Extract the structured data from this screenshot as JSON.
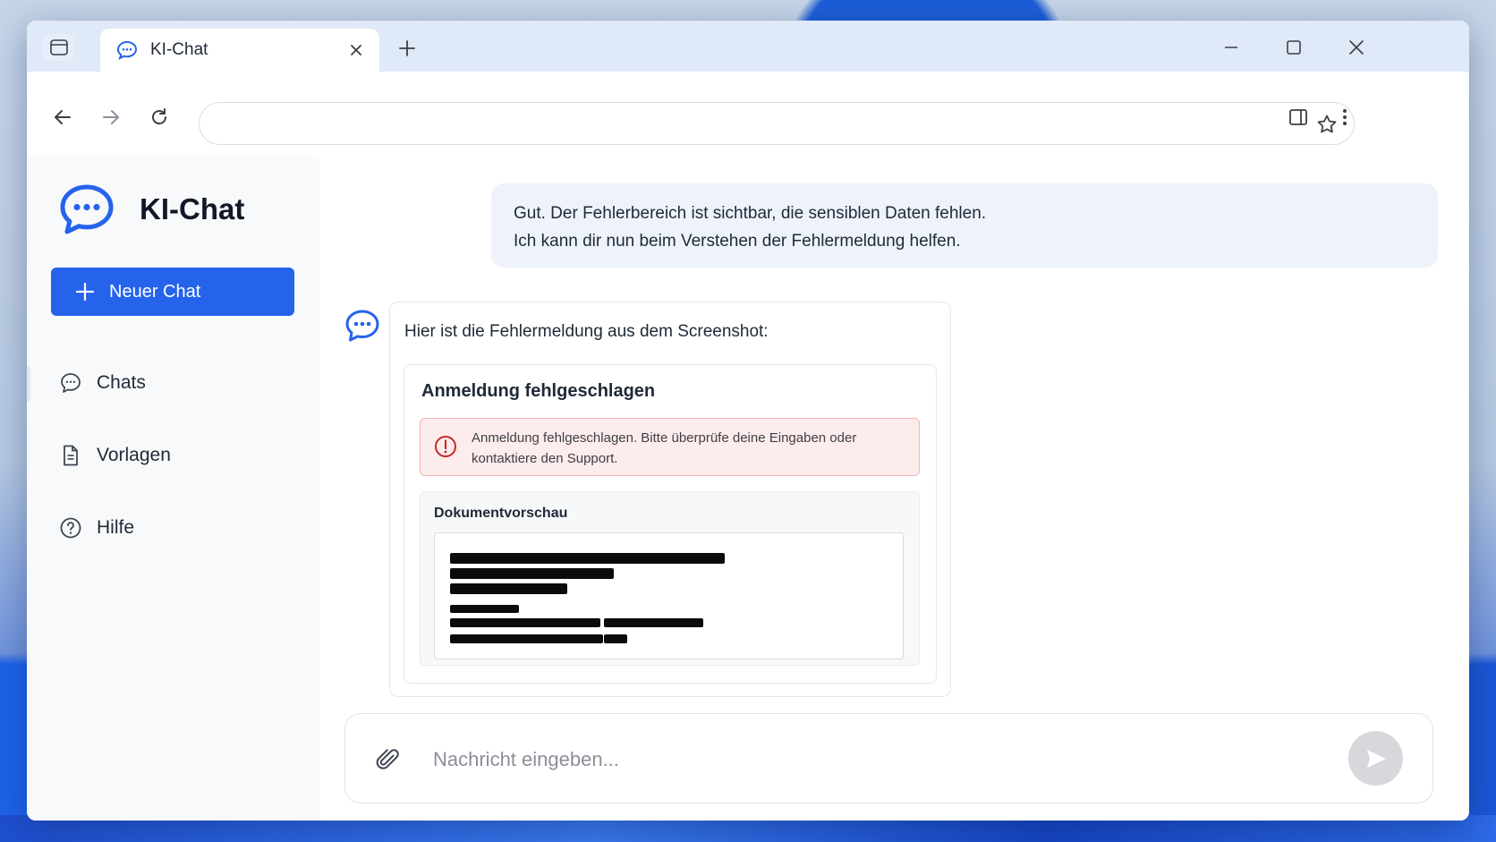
{
  "browser": {
    "tab_title": "KI-Chat",
    "address_value": ""
  },
  "sidebar": {
    "brand_title": "KI-Chat",
    "new_chat_label": "Neuer Chat",
    "items": [
      {
        "label": "Chats",
        "icon": "chat-bubble-icon"
      },
      {
        "label": "Vorlagen",
        "icon": "document-icon"
      },
      {
        "label": "Hilfe",
        "icon": "help-circle-icon"
      }
    ]
  },
  "conversation": {
    "user_message": {
      "line1": "Gut. Der Fehlerbereich ist sichtbar, die sensiblen Daten fehlen.",
      "line2": "Ich kann dir nun beim Verstehen der Fehlermeldung helfen."
    },
    "assistant_message": {
      "intro": "Hier ist die Fehlermeldung aus dem Screenshot:",
      "error_card": {
        "title": "Anmeldung fehlgeschlagen",
        "alert_text": "Anmeldung fehlgeschlagen. Bitte überprüfe deine Eingaben oder kontaktiere den Support.",
        "preview_title": "Dokumentvorschau"
      }
    }
  },
  "composer": {
    "placeholder": "Nachricht eingeben..."
  },
  "colors": {
    "accent": "#2563eb",
    "alert_bg": "#fdecec",
    "alert_border": "#f3b4b4",
    "alert_icon": "#c62828",
    "user_bubble": "#eef3fb",
    "send_button": "#d6d8dc"
  }
}
